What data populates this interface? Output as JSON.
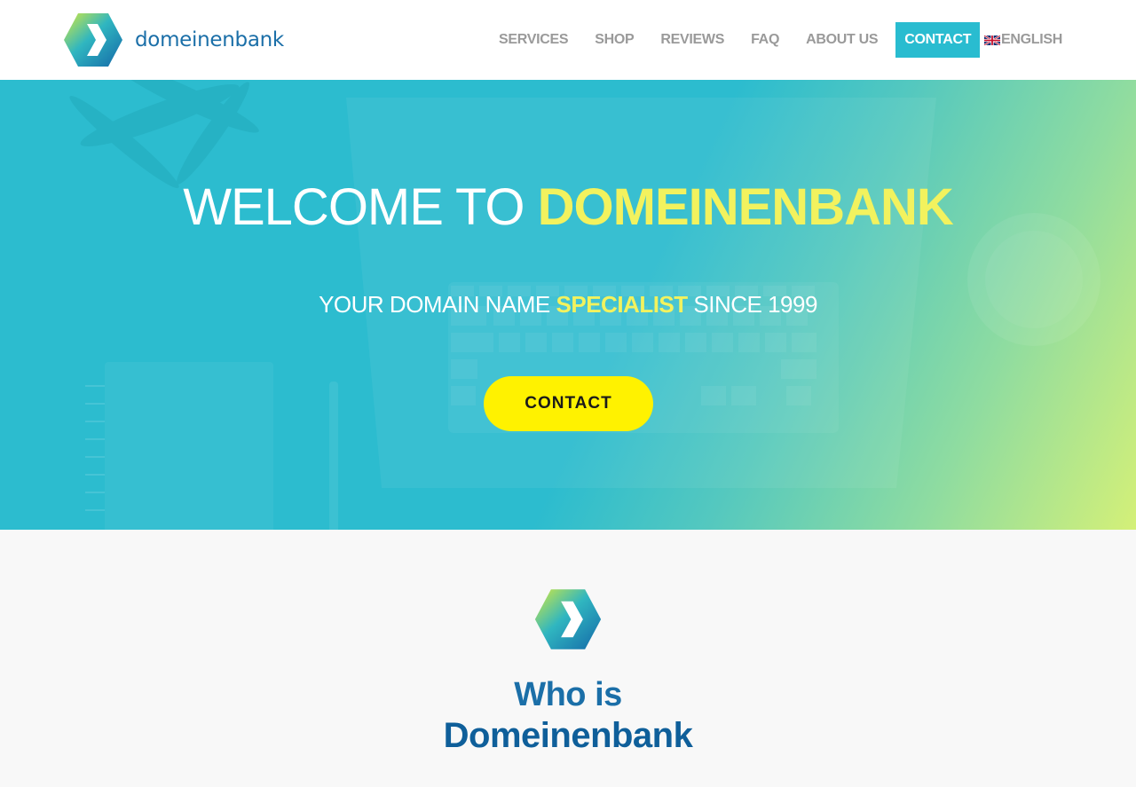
{
  "brand": {
    "name": "domeinenbank",
    "primary_color": "#1b6fa8",
    "accent_color": "#29bcd0",
    "highlight_color": "#f2f25e"
  },
  "nav": {
    "items": [
      {
        "label": "SERVICES"
      },
      {
        "label": "SHOP"
      },
      {
        "label": "REVIEWS"
      },
      {
        "label": "FAQ"
      },
      {
        "label": "ABOUT US"
      },
      {
        "label": "CONTACT",
        "active": true
      }
    ],
    "language": {
      "label": "ENGLISH",
      "icon": "uk-flag-icon"
    }
  },
  "hero": {
    "title_prefix": "WELCOME TO ",
    "title_accent": "DOMEINENBANK",
    "subtitle_prefix": "YOUR DOMAIN NAME ",
    "subtitle_accent": "SPECIALIST",
    "subtitle_suffix": " SINCE 1999",
    "button_label": "CONTACT",
    "button_color": "#fff200"
  },
  "about": {
    "heading_line1": "Who is",
    "heading_line2": "Domeinenbank",
    "icon": "domeinenbank-logo-icon"
  }
}
